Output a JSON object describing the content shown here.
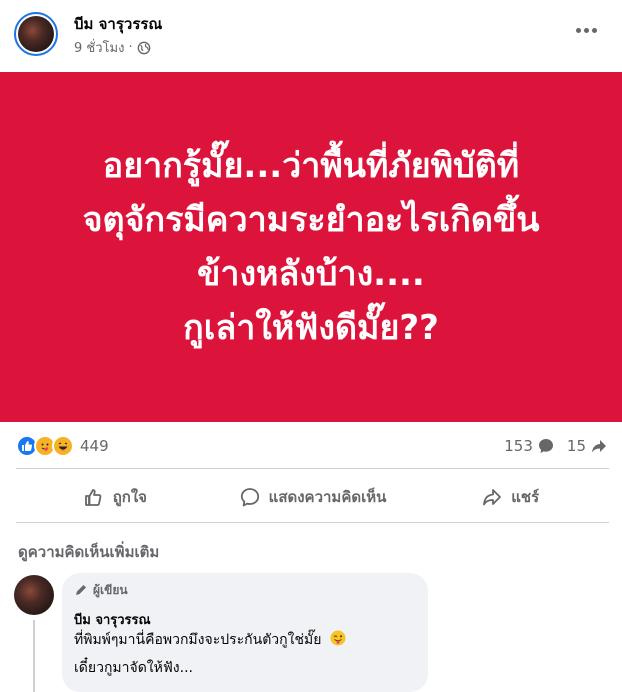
{
  "post": {
    "author_name": "บีม จารุวรรณ",
    "time": "9 ชั่วโมง",
    "separator": "·",
    "privacy_icon": "globe-icon",
    "more_icon": "more-options-icon"
  },
  "banner": {
    "background_color": "#dc143c",
    "text_color": "#ffffff",
    "lines": [
      "อยากรู้มั๊ย...ว่าพื้นที่ภัยพิบัติที่",
      "จตุจักรมีความระยำอะไรเกิดขึ้น",
      "ข้างหลังบ้าง....",
      "กูเล่าให้ฟังดีมั๊ย??"
    ]
  },
  "stats": {
    "reaction_icons": [
      "like-icon",
      "care-icon",
      "haha-icon"
    ],
    "reaction_count": "449",
    "comment_count": "153",
    "share_count": "15"
  },
  "actions": {
    "like_label": "ถูกใจ",
    "comment_label": "แสดงความคิดเห็น",
    "share_label": "แชร์"
  },
  "comments": {
    "more_label": "ดูความคิดเห็นเพิ่มเติม",
    "items": [
      {
        "badge": "ผู้เขียน",
        "author": "บีม จารุวรรณ",
        "line1": "ที่พิมพ์ๆมานี่คือพวกมึงจะประกันตัวกูใช่มั๊ย",
        "line1_emoji": "winking-tongue-emoji",
        "line2": "เดี๋ยวกูมาจัดให้ฟัง..."
      }
    ]
  },
  "colors": {
    "brand_blue": "#1877f2",
    "secondary_text": "#65676b",
    "bubble_bg": "#f0f2f5"
  }
}
